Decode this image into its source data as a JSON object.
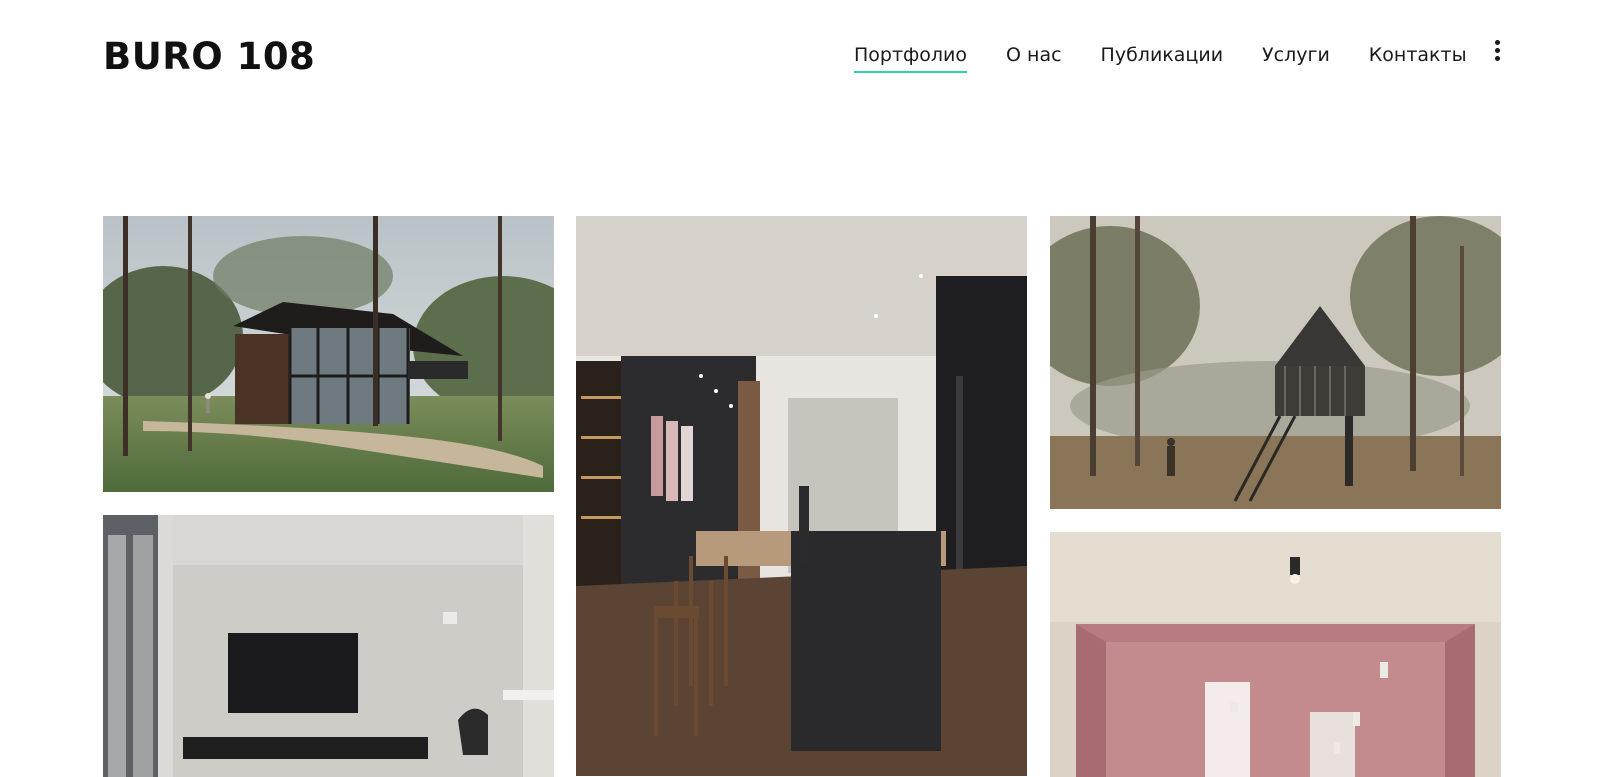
{
  "brand": {
    "logo_text": "BURO 108"
  },
  "nav": {
    "items": [
      {
        "label": "Портфолио",
        "active": true
      },
      {
        "label": "О нас",
        "active": false
      },
      {
        "label": "Публикации",
        "active": false
      },
      {
        "label": "Услуги",
        "active": false
      },
      {
        "label": "Контакты",
        "active": false
      }
    ],
    "more_icon": "vertical-dots-icon",
    "accent_color": "#2fd3a8"
  },
  "portfolio": {
    "tiles": [
      {
        "subject": "forest house with glass facade rendering"
      },
      {
        "subject": "dark kitchen interior with wooden bar counter"
      },
      {
        "subject": "treehouse cabin on stilts in forest"
      },
      {
        "subject": "living room with wall-mounted TV"
      },
      {
        "subject": "pink hallway interior with ceiling lamps"
      }
    ]
  }
}
